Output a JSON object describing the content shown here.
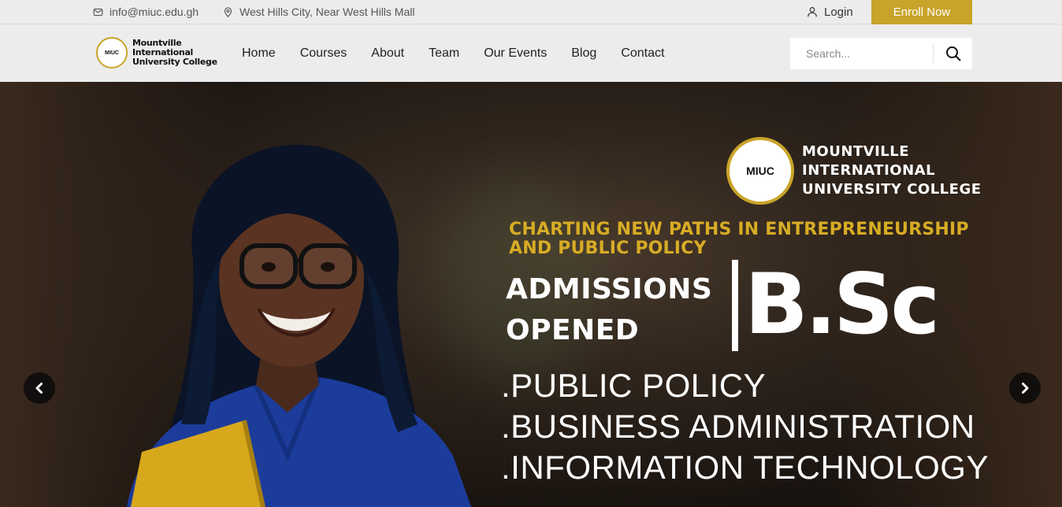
{
  "topbar": {
    "email": "info@miuc.edu.gh",
    "address": "West Hills City, Near West Hills Mall",
    "login_label": "Login",
    "enroll_label": "Enroll Now"
  },
  "logo": {
    "seal_text": "MIUC",
    "line1": "Mountville",
    "line2": "International",
    "line3": "University College"
  },
  "nav": {
    "items": [
      "Home",
      "Courses",
      "About",
      "Team",
      "Our Events",
      "Blog",
      "Contact"
    ]
  },
  "search": {
    "placeholder": "Search..."
  },
  "hero": {
    "brand_seal_text": "MIUC",
    "brand_line1": "MOUNTVILLE",
    "brand_line2": "INTERNATIONAL",
    "brand_line3": "UNIVERSITY COLLEGE",
    "tagline_line1": "CHARTING NEW PATHS IN ENTREPRENEURSHIP",
    "tagline_line2": "AND PUBLIC POLICY",
    "admissions_line1": "ADMISSIONS",
    "admissions_line2": "OPENED",
    "degree": "B.Sc",
    "programs": [
      ".PUBLIC POLICY",
      ".BUSINESS ADMINISTRATION",
      ".INFORMATION TECHNOLOGY"
    ]
  },
  "colors": {
    "accent": "#c9a42a",
    "topbar_bg": "#ececec",
    "tagline": "#d8ac25",
    "shirt": "#1c3c9c"
  },
  "icons": {
    "email": "envelope-icon",
    "address": "map-pin-icon",
    "login": "user-icon",
    "search": "search-icon",
    "prev": "chevron-left-icon",
    "next": "chevron-right-icon"
  }
}
